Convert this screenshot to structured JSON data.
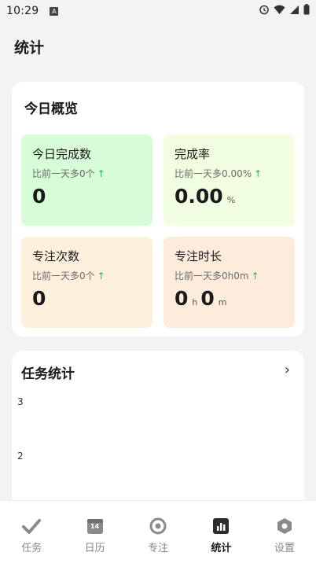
{
  "status_bar": {
    "time": "10:29",
    "a_icon": "A"
  },
  "page": {
    "title": "统计"
  },
  "overview": {
    "title": "今日概览",
    "tiles": [
      {
        "label": "今日完成数",
        "sub": "比前一天多0个",
        "value": "0",
        "unit": ""
      },
      {
        "label": "完成率",
        "sub": "比前一天多0.00%",
        "value": "0.00",
        "unit": "%"
      },
      {
        "label": "专注次数",
        "sub": "比前一天多0个",
        "value": "0",
        "unit": ""
      },
      {
        "label": "专注时长",
        "sub": "比前一天多0h0m",
        "value_h": "0",
        "unit_h": "h",
        "value_m": "0",
        "unit_m": "m"
      }
    ],
    "up_arrow": "↑"
  },
  "task_stats": {
    "title": "任务统计",
    "chevron": "›",
    "chart_data": {
      "type": "bar",
      "title": "任务统计",
      "ytick_labels": [
        "3",
        "2"
      ]
    }
  },
  "tabbar": {
    "items": [
      {
        "label": "任务",
        "icon": "check-icon"
      },
      {
        "label": "日历",
        "icon": "calendar-icon",
        "badge": "14"
      },
      {
        "label": "专注",
        "icon": "target-icon"
      },
      {
        "label": "统计",
        "icon": "bar-chart-icon",
        "active": true
      },
      {
        "label": "设置",
        "icon": "hexagon-gear-icon"
      }
    ]
  },
  "colors": {
    "tile_done": "#d8fcd8",
    "tile_rate": "#f1fedf",
    "tile_count": "#fdf0dc",
    "tile_duration": "#fdecdc",
    "up_arrow": "#2bb24c"
  }
}
